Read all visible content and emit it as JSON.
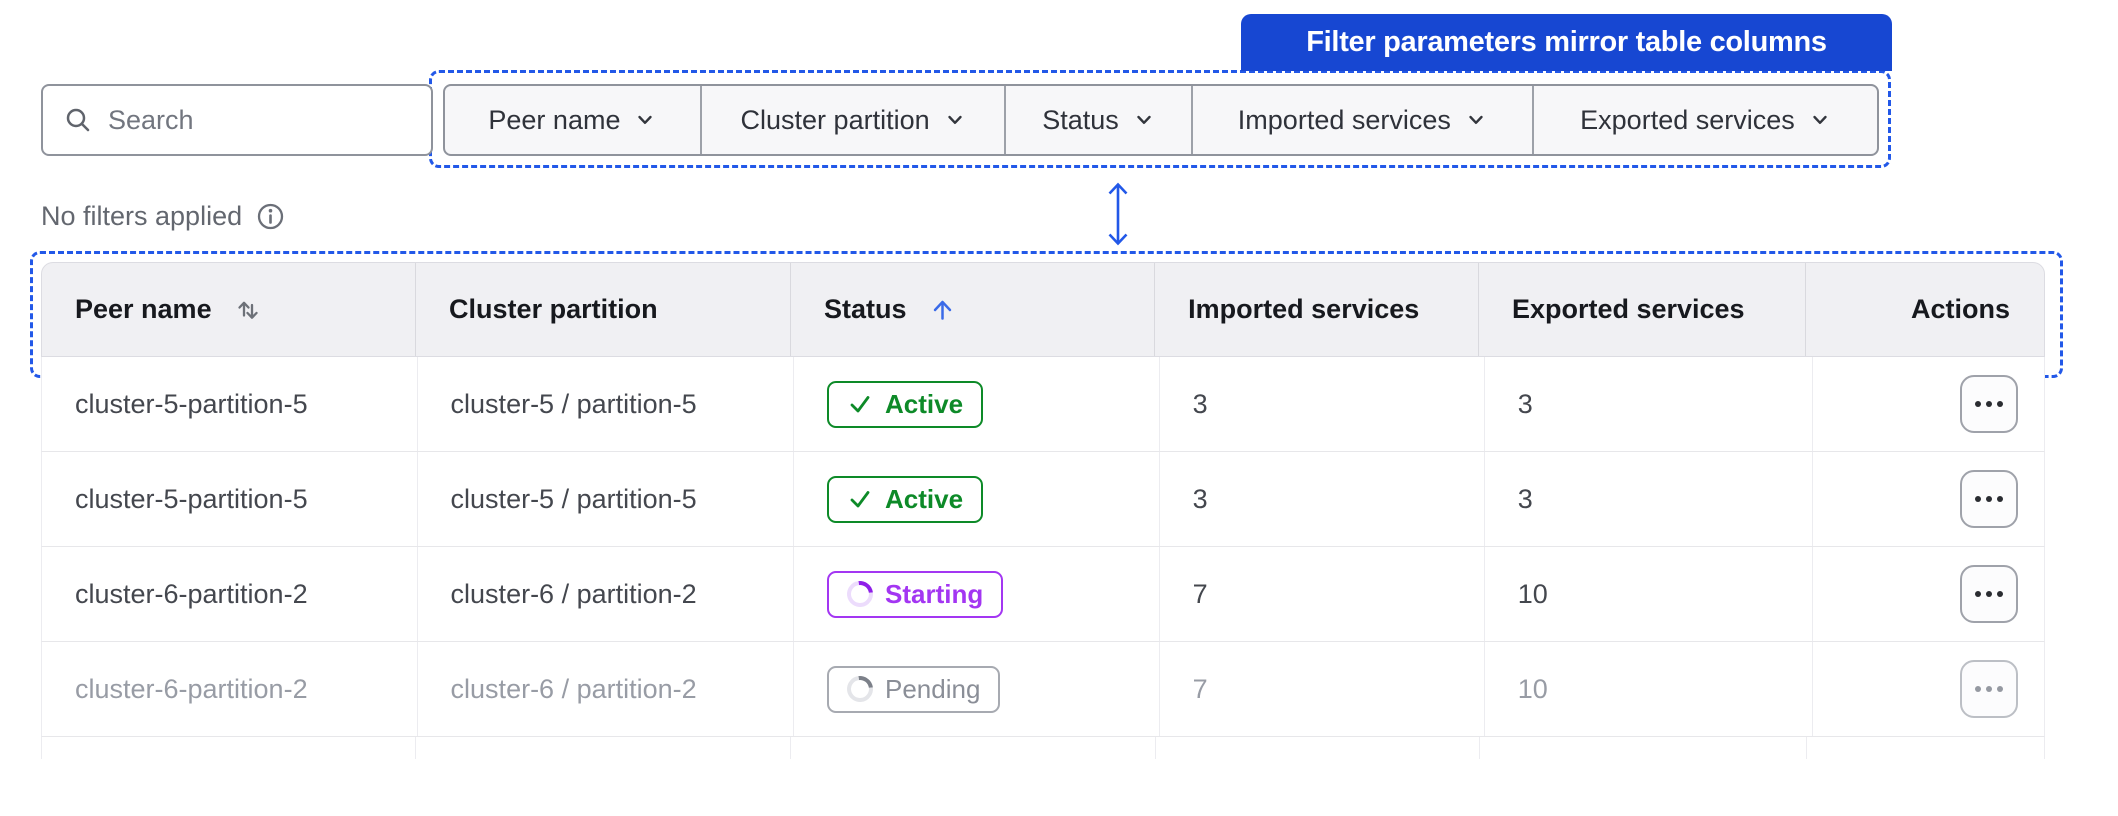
{
  "callout": {
    "label": "Filter parameters mirror table columns"
  },
  "toolbar": {
    "search_placeholder": "Search",
    "filters": [
      {
        "label": "Peer name"
      },
      {
        "label": "Cluster partition"
      },
      {
        "label": "Status"
      },
      {
        "label": "Imported services"
      },
      {
        "label": "Exported services"
      }
    ]
  },
  "filter_summary": {
    "text": "No filters applied"
  },
  "table": {
    "columns": [
      {
        "label": "Peer name",
        "sort": "sortable",
        "align": "left"
      },
      {
        "label": "Cluster partition",
        "sort": "none",
        "align": "left"
      },
      {
        "label": "Status",
        "sort": "ascending",
        "align": "left"
      },
      {
        "label": "Imported services",
        "sort": "none",
        "align": "left"
      },
      {
        "label": "Exported services",
        "sort": "none",
        "align": "left"
      },
      {
        "label": "Actions",
        "sort": "none",
        "align": "right"
      }
    ],
    "rows": [
      {
        "peer_name": "cluster-5-partition-5",
        "cluster_partition": "cluster-5 / partition-5",
        "status": "Active",
        "status_kind": "active",
        "imported_services": "3",
        "exported_services": "3",
        "muted": false
      },
      {
        "peer_name": "cluster-5-partition-5",
        "cluster_partition": "cluster-5 / partition-5",
        "status": "Active",
        "status_kind": "active",
        "imported_services": "3",
        "exported_services": "3",
        "muted": false
      },
      {
        "peer_name": "cluster-6-partition-2",
        "cluster_partition": "cluster-6 / partition-2",
        "status": "Starting",
        "status_kind": "starting",
        "imported_services": "7",
        "exported_services": "10",
        "muted": false
      },
      {
        "peer_name": "cluster-6-partition-2",
        "cluster_partition": "cluster-6 / partition-2",
        "status": "Pending",
        "status_kind": "pending",
        "imported_services": "7",
        "exported_services": "10",
        "muted": true
      }
    ]
  },
  "icons": {
    "search": "magnifying-glass",
    "filter_dropdown": "chevron-down",
    "summary_info": "info-circle",
    "sort_sortable": "arrows-up-down",
    "sort_ascending": "arrow-up",
    "status_active": "check",
    "status_starting": "spinner",
    "status_pending": "spinner",
    "row_actions": "ellipsis-horizontal",
    "mirror_link": "double-headed-vertical-arrow"
  },
  "colors": {
    "callout_bg": "#1747d2",
    "highlight_blue": "#2258e8",
    "sort_ascending_arrow": "#3a6ae8",
    "status_active": "#0d8a28",
    "status_starting": "#a336f2",
    "status_pending": "#6d7179",
    "header_text": "#17191e",
    "cell_text": "#44474e",
    "muted_text": "#989ca5",
    "gray_text": "#63676f"
  }
}
